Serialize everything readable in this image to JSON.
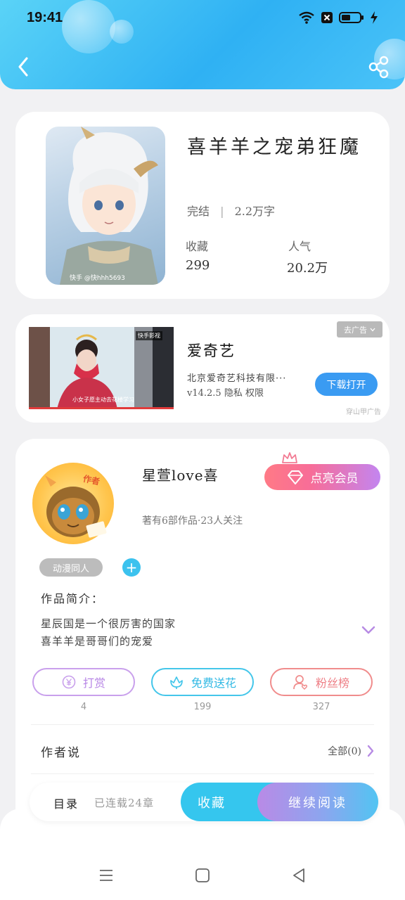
{
  "status_bar": {
    "time": "19:41"
  },
  "book": {
    "title": "喜羊羊之宠弟狂魔",
    "status": "完结",
    "word_count": "2.2万字",
    "stats": [
      {
        "label": "收藏",
        "value": "299"
      },
      {
        "label": "人气",
        "value": "20.2万"
      }
    ],
    "cover_watermark": "快手 @快hhh5693"
  },
  "ad": {
    "title": "爱奇艺",
    "company": "北京爱奇艺科技有限···",
    "version_info": "v14.2.5  隐私  权限",
    "close_label": "去广告",
    "download_label": "下载打开",
    "source": "穿山甲广告",
    "thumb_caption": "小女子愿主动去花楼学习",
    "thumb_badge": "快手影视"
  },
  "author": {
    "name": "星萱love喜",
    "avatar_badge": "作者",
    "summary": "著有6部作品·23人关注",
    "vip_label": "点亮会员",
    "tag": "动漫同人",
    "intro_label": "作品简介：",
    "intro_lines": [
      "星辰国是一个很厉害的国家",
      "喜羊羊是哥哥们的宠爱"
    ],
    "actions": [
      {
        "label": "打赏",
        "count": "4",
        "color": "#c9a0ec"
      },
      {
        "label": "免费送花",
        "count": "199",
        "color": "#44c6ea"
      },
      {
        "label": "粉丝榜",
        "count": "327",
        "color": "#f08c8c"
      }
    ],
    "author_says_label": "作者说",
    "all_label": "全部(0)"
  },
  "bottom_bar": {
    "toc_label": "目录",
    "toc_status": "已连载24章",
    "collect_label": "收藏",
    "read_label": "继续阅读"
  },
  "colors": {
    "header_blue": "#2fb1f3",
    "accent_cyan": "#35c6ee",
    "vip_pink": "#f76d98",
    "vip_purple": "#c385f0"
  }
}
